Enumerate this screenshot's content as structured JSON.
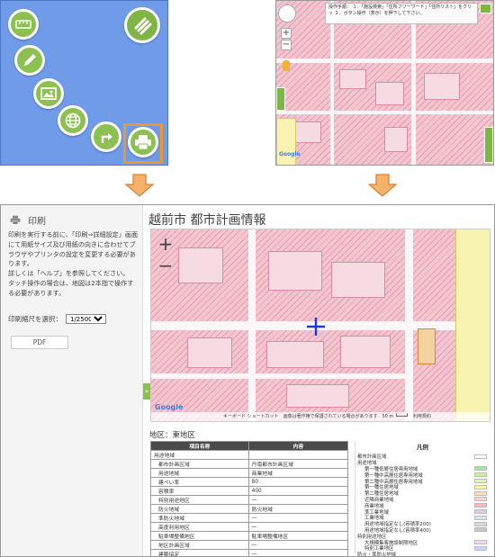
{
  "menu_panel": {
    "buttons": [
      {
        "name": "ruler-icon"
      },
      {
        "name": "pencil-icon"
      },
      {
        "name": "image-icon"
      },
      {
        "name": "globe-icon"
      },
      {
        "name": "turn-arrow-icon"
      },
      {
        "name": "printer-icon"
      },
      {
        "name": "menu-icon"
      }
    ],
    "highlight_color": "#f0962e",
    "button_color": "#8cc152"
  },
  "small_map": {
    "tip_text": "操作手順：\n１．「施設検索」「住所フリーワード」「住所リスト」をクリッ\n２．ボタン操作（表示）を押下して下さい。",
    "zoom_in": "+",
    "zoom_out": "−",
    "google": "Google"
  },
  "print_panel": {
    "heading": "印刷",
    "description": "印刷を実行する前に、「印刷⇒詳細設定」画面にて用紙サイズ及び用紙の向きに合わせてブラウザやプリンタの設定を変更する必要があります。\n詳しくは「ヘルプ」を参照してください。\nタッチ操作の場合は、地図は2本指で操作する必要があります。",
    "scale_label": "印刷縮尺を選択：",
    "scale_value": "1/2500",
    "pdf_label": "PDF",
    "collapse": "«",
    "title": "越前市 都市計画情報",
    "zoom_in": "+",
    "zoom_out": "−",
    "map_footer": "キーボード ショートカット　画像は著作権で保護されている場合があります　50 m ┗━━━┛　利用規約",
    "google": "Google",
    "zone_label": "地区：東地区",
    "table": {
      "headers": [
        "項目名称",
        "内容"
      ],
      "rows": [
        [
          "用途地域",
          ""
        ],
        [
          "都市計画区域",
          "丹南都市計画区域"
        ],
        [
          "用途地域",
          "商業地域"
        ],
        [
          "建ぺい率",
          "80"
        ],
        [
          "容積率",
          "400"
        ],
        [
          "特別用途地区",
          "―"
        ],
        [
          "防火地域",
          "防火地域"
        ],
        [
          "準防火地域",
          "―"
        ],
        [
          "高度利用地区",
          "―"
        ],
        [
          "駐車場整備地区",
          "駐車場整備地区"
        ],
        [
          "地区計画区域",
          "―"
        ],
        [
          "建築協定",
          "―"
        ]
      ]
    },
    "legend": {
      "title": "凡例",
      "items": [
        {
          "label": "都市計画区域",
          "color": "#ffffff"
        },
        {
          "label": "用途地域",
          "color": ""
        },
        {
          "label": "第一種低層住居専用地域",
          "color": "#a8e6a0"
        },
        {
          "label": "第一種中高層住居専用地域",
          "color": "#c9ef9f"
        },
        {
          "label": "第二種中高層住居専用地域",
          "color": "#e3f5a8"
        },
        {
          "label": "第一種住居地域",
          "color": "#fbf7a8"
        },
        {
          "label": "第二種住居地域",
          "color": "#fbe3a8"
        },
        {
          "label": "近隣商業地域",
          "color": "#fbd0c8"
        },
        {
          "label": "商業地域",
          "color": "#f7b6c8"
        },
        {
          "label": "準工業地域",
          "color": "#e3c6ef"
        },
        {
          "label": "工業地域",
          "color": "#d6e3f5"
        },
        {
          "label": "用途地域指定なし(容積率200)",
          "color": "#d8d8d8"
        },
        {
          "label": "用途地域指定なし(容積率400)",
          "color": "#c8c8c8"
        },
        {
          "label": "特別用途地区",
          "color": ""
        },
        {
          "label": "大規模集客施設制限地区",
          "color": "#f3d7f0"
        },
        {
          "label": "特別工業地区",
          "color": "#c8d6f5"
        },
        {
          "label": "防火・準防火地域",
          "color": ""
        }
      ]
    }
  }
}
